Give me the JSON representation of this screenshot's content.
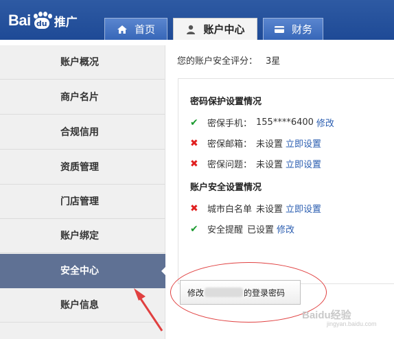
{
  "header": {
    "logo_bai": "Bai",
    "logo_du": "du",
    "logo_suffix": "推广",
    "tabs": [
      {
        "label": "首页",
        "icon": "home-icon",
        "active": false
      },
      {
        "label": "账户中心",
        "icon": "user-icon",
        "active": true
      },
      {
        "label": "财务",
        "icon": "card-icon",
        "active": false
      }
    ]
  },
  "sidebar": {
    "items": [
      {
        "label": "账户概况"
      },
      {
        "label": "商户名片"
      },
      {
        "label": "合规信用"
      },
      {
        "label": "资质管理"
      },
      {
        "label": "门店管理"
      },
      {
        "label": "账户绑定"
      },
      {
        "label": "安全中心",
        "active": true
      },
      {
        "label": "账户信息"
      }
    ]
  },
  "main": {
    "score_label": "您的账户安全评分：",
    "score_value": "3星",
    "password_section": "密码保护设置情况",
    "account_section": "账户安全设置情况",
    "rows": [
      {
        "label": "密保手机：",
        "value": "155****6400",
        "link": "修改",
        "ok": true
      },
      {
        "label": "密保邮箱：",
        "value": "未设置",
        "link": "立即设置",
        "ok": false
      },
      {
        "label": "密保问题：",
        "value": "未设置",
        "link": "立即设置",
        "ok": false
      },
      {
        "label": "城市白名单",
        "value": "未设置",
        "link": "立即设置",
        "ok": false
      },
      {
        "label": "安全提醒",
        "value": "已设置",
        "link": "修改",
        "ok": true
      }
    ],
    "button_prefix": "修改",
    "button_suffix": "的登录密码"
  },
  "watermark": {
    "text": "Baidu经验",
    "sub": "jingyan.baidu.com"
  },
  "colors": {
    "brand_blue": "#1e4a96",
    "active_sidebar": "#5f7194",
    "link": "#2a5db0",
    "ok": "#1a9a2e",
    "bad": "#e02020",
    "annotation": "#e04040"
  }
}
